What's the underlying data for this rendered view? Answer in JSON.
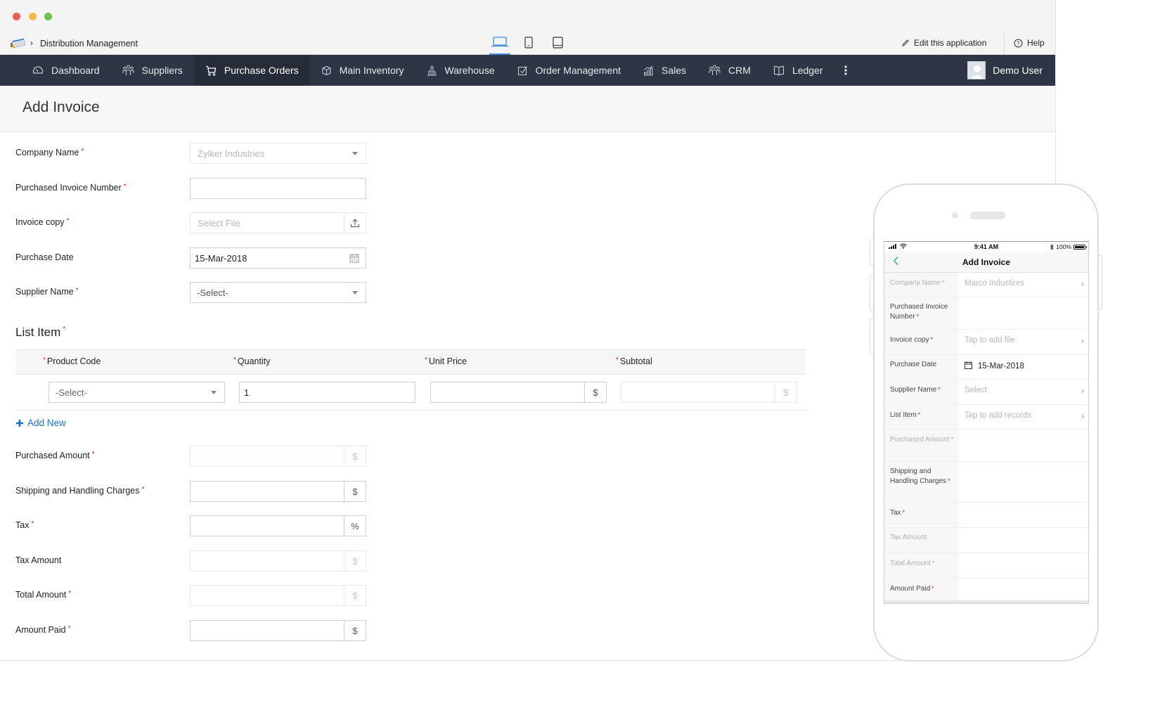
{
  "window": {
    "app_name": "Distribution Management",
    "breadcrumb_separator": "›",
    "device_views": [
      "laptop",
      "phone",
      "tablet"
    ],
    "active_device_view": "laptop",
    "edit_app_label": "Edit this application",
    "help_label": "Help"
  },
  "nav": {
    "items": [
      {
        "label": "Dashboard",
        "icon": "dashboard-icon"
      },
      {
        "label": "Suppliers",
        "icon": "people-icon"
      },
      {
        "label": "Purchase Orders",
        "icon": "cart-icon",
        "active": true
      },
      {
        "label": "Main Inventory",
        "icon": "box-icon"
      },
      {
        "label": "Warehouse",
        "icon": "warehouse-icon"
      },
      {
        "label": "Order Management",
        "icon": "checkbox-icon"
      },
      {
        "label": "Sales",
        "icon": "bar-chart-icon"
      },
      {
        "label": "CRM",
        "icon": "people-icon"
      },
      {
        "label": "Ledger",
        "icon": "book-icon"
      }
    ],
    "user_name": "Demo User"
  },
  "page": {
    "title": "Add Invoice"
  },
  "form": {
    "company_name": {
      "label": "Company Name",
      "required": true,
      "value": "Zylker Industries",
      "disabled": true
    },
    "purchased_invoice_number": {
      "label": "Purchased Invoice Number",
      "required": true,
      "value": ""
    },
    "invoice_copy": {
      "label": "Invoice copy",
      "required": true,
      "placeholder": "Select File"
    },
    "purchase_date": {
      "label": "Purchase Date",
      "required": false,
      "value": "15-Mar-2018"
    },
    "supplier_name": {
      "label": "Supplier Name",
      "required": true,
      "value": "-Select-"
    },
    "list_item": {
      "title": "List Item",
      "required": true,
      "columns": [
        "Product Code",
        "Quantity",
        "Unit Price",
        "Subtotal"
      ],
      "rows": [
        {
          "product_code": "-Select-",
          "quantity": "1",
          "unit_price": "",
          "subtotal": ""
        }
      ],
      "add_new_label": "Add New"
    },
    "purchased_amount": {
      "label": "Purchased Amount",
      "required": true,
      "addon": "$",
      "disabled": true
    },
    "shipping_charges": {
      "label": "Shipping and Handling Charges",
      "required": true,
      "addon": "$"
    },
    "tax": {
      "label": "Tax",
      "required": true,
      "addon": "%"
    },
    "tax_amount": {
      "label": "Tax Amount",
      "required": false,
      "addon": "$",
      "disabled": true
    },
    "total_amount": {
      "label": "Total Amount",
      "required": true,
      "addon": "$",
      "disabled": true
    },
    "amount_paid": {
      "label": "Amount Paid",
      "required": true,
      "addon": "$"
    }
  },
  "mobile": {
    "status": {
      "time": "9:41 AM",
      "battery": "100%",
      "battery_level": 1.0
    },
    "title": "Add Invoice",
    "rows": [
      {
        "label": "Company Name",
        "required": true,
        "muted": true,
        "value": "Marco Industires",
        "value_style": "muted",
        "chevron": true
      },
      {
        "label": "Purchased Invoice Number",
        "required": true,
        "muted": false,
        "value": "",
        "chevron": false
      },
      {
        "label": "Invoice copy",
        "required": true,
        "muted": false,
        "value": "Tap to add file",
        "value_style": "placeholder",
        "chevron": true
      },
      {
        "label": "Purchase Date",
        "required": false,
        "muted": false,
        "value": "15-Mar-2018",
        "value_style": "dark",
        "chevron": false,
        "icon": "calendar-icon"
      },
      {
        "label": "Supplier Name",
        "required": true,
        "muted": false,
        "value": "Select",
        "value_style": "placeholder",
        "chevron": true
      },
      {
        "label": "List Item",
        "required": true,
        "muted": false,
        "value": "Tap to add records",
        "value_style": "placeholder",
        "chevron": true
      },
      {
        "label": "Purchased Amount",
        "required": true,
        "muted": true,
        "value": "",
        "chevron": false
      },
      {
        "label": "Shipping and Handling Charges",
        "required": true,
        "muted": false,
        "value": "",
        "chevron": false
      },
      {
        "label": "Tax",
        "required": true,
        "muted": false,
        "value": "",
        "chevron": false
      },
      {
        "label": "Tax Amount",
        "required": false,
        "muted": true,
        "value": "",
        "chevron": false
      },
      {
        "label": "Total Amount",
        "required": true,
        "muted": true,
        "value": "",
        "chevron": false
      },
      {
        "label": "Amount Paid",
        "required": true,
        "muted": false,
        "value": "",
        "chevron": false
      }
    ]
  },
  "colors": {
    "nav_bg": "#2e3544",
    "nav_active_bg": "#262c38",
    "accent_link": "#1a73c9",
    "required_marker": "#e82626",
    "mobile_back": "#2bb3a9"
  }
}
